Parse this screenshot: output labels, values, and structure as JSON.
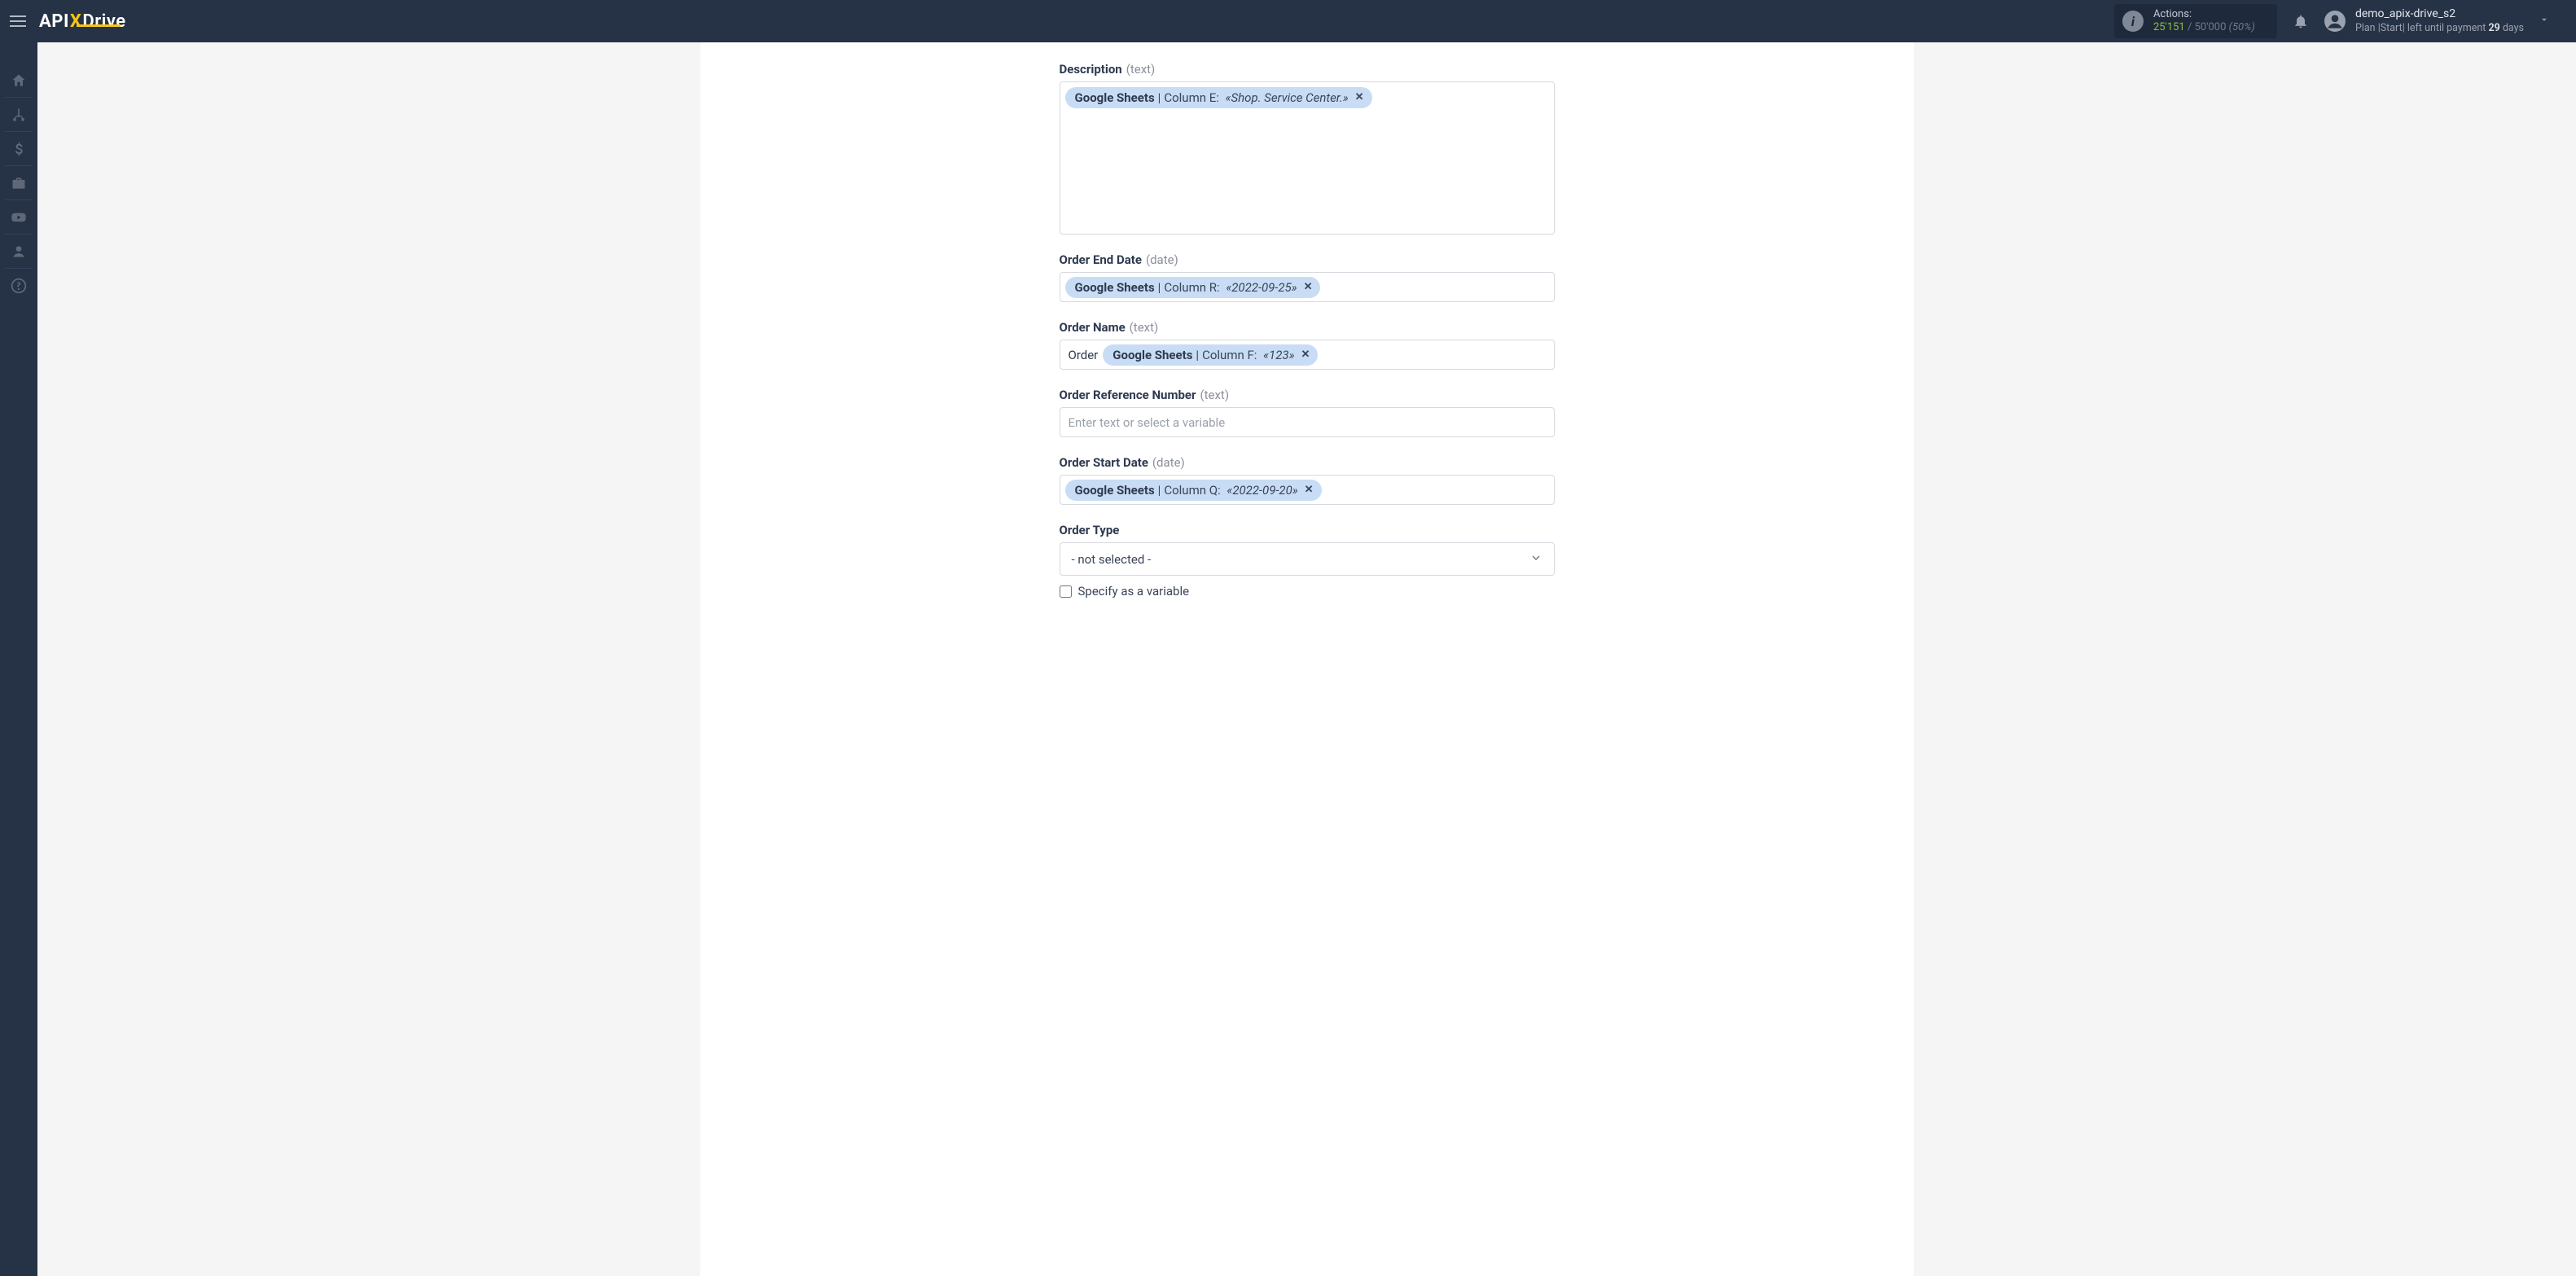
{
  "brand": {
    "part1": "API",
    "partX": "X",
    "part2": "Drive"
  },
  "header": {
    "actions_label": "Actions:",
    "actions_used": "25'151",
    "actions_total": "50'000",
    "actions_pct": "(50%)",
    "user_name": "demo_apix-drive_s2",
    "plan_prefix": "Plan",
    "plan_name": "Start",
    "plan_mid": "left until payment",
    "plan_days": "29",
    "plan_days_suffix": "days"
  },
  "sidebar": {
    "items": [
      "home",
      "connections",
      "billing",
      "toolbox",
      "video",
      "account",
      "help"
    ]
  },
  "fields": {
    "description": {
      "label": "Description",
      "type": "(text)",
      "chip": {
        "source": "Google Sheets",
        "column": "Column E:",
        "value": "«Shop. Service Center.»"
      }
    },
    "order_end_date": {
      "label": "Order End Date",
      "type": "(date)",
      "chip": {
        "source": "Google Sheets",
        "column": "Column R:",
        "value": "«2022-09-25»"
      }
    },
    "order_name": {
      "label": "Order Name",
      "type": "(text)",
      "prefix_text": "Order",
      "chip": {
        "source": "Google Sheets",
        "column": "Column F:",
        "value": "«123»"
      }
    },
    "order_ref": {
      "label": "Order Reference Number",
      "type": "(text)",
      "placeholder": "Enter text or select a variable"
    },
    "order_start_date": {
      "label": "Order Start Date",
      "type": "(date)",
      "chip": {
        "source": "Google Sheets",
        "column": "Column Q:",
        "value": "«2022-09-20»"
      }
    },
    "order_type": {
      "label": "Order Type",
      "selected": "- not selected -",
      "checkbox_label": "Specify as a variable"
    }
  }
}
